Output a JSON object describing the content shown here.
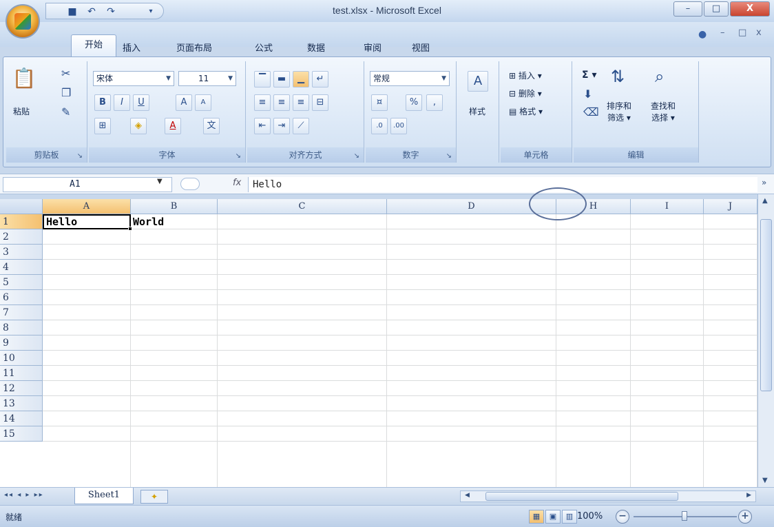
{
  "window": {
    "title": "test.xlsx - Microsoft Excel",
    "minimize": "–",
    "maximize": "□",
    "close": "X"
  },
  "qat": {
    "save_icon": "save-icon",
    "undo_icon": "undo-icon",
    "redo_icon": "redo-icon"
  },
  "tabs": [
    {
      "label": "开始"
    },
    {
      "label": "插入"
    },
    {
      "label": "页面布局"
    },
    {
      "label": "公式"
    },
    {
      "label": "数据"
    },
    {
      "label": "审阅"
    },
    {
      "label": "视图"
    }
  ],
  "ribbon": {
    "clipboard": {
      "paste": "粘贴",
      "label": "剪贴板"
    },
    "font": {
      "name": "宋体",
      "size": "11",
      "bold": "B",
      "italic": "I",
      "underline": "U",
      "grow": "A",
      "shrink": "A",
      "label": "字体"
    },
    "alignment": {
      "label": "对齐方式"
    },
    "number": {
      "format": "常规",
      "percent": "%",
      "comma": ",",
      "label": "数字"
    },
    "styles": {
      "label": "样式"
    },
    "cells": {
      "insert": "插入",
      "delete": "删除",
      "format": "格式",
      "label": "单元格"
    },
    "editing": {
      "sum": "Σ",
      "sort1": "排序和",
      "sort2": "筛选",
      "find1": "查找和",
      "find2": "选择",
      "label": "编辑"
    }
  },
  "formula_bar": {
    "name_box": "A1",
    "fx": "fx",
    "value": "Hello"
  },
  "columns": [
    "A",
    "B",
    "C",
    "D",
    "H",
    "I",
    "J"
  ],
  "rows": [
    "1",
    "2",
    "3",
    "4",
    "5",
    "6",
    "7",
    "8",
    "9",
    "10",
    "11",
    "12",
    "13",
    "14",
    "15"
  ],
  "cells": {
    "A1": "Hello",
    "B1": "World"
  },
  "sheet_tabs": {
    "active": "Sheet1"
  },
  "status": {
    "text": "就绪",
    "zoom": "100%",
    "zoom_in": "+",
    "zoom_out": "−"
  }
}
